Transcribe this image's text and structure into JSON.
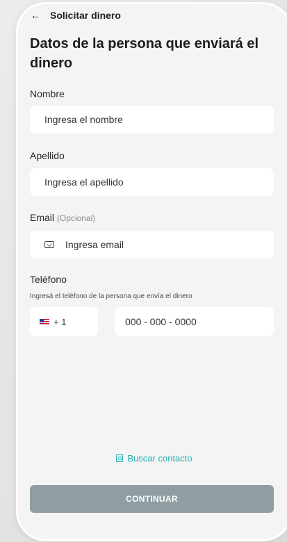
{
  "header": {
    "back_icon": "back-arrow-icon",
    "title": "Solicitar dinero"
  },
  "section": {
    "title": "Datos de la persona que enviará el dinero"
  },
  "form": {
    "name": {
      "label": "Nombre",
      "placeholder": "Ingresa el nombre"
    },
    "lastname": {
      "label": "Apellido",
      "placeholder": "Ingresa el apellido"
    },
    "email": {
      "label": "Email",
      "optional": "(Opcional)",
      "placeholder": "Ingresa email",
      "icon": "mail-icon"
    },
    "phone": {
      "label": "Teléfono",
      "helper": "Ingresá el teléfono de la persona que envía el dinero",
      "country_code": "+ 1",
      "country_flag": "us-flag-icon",
      "placeholder": "000 - 000 - 0000"
    }
  },
  "actions": {
    "search_contact": "Buscar contacto",
    "continue": "CONTINUAR"
  },
  "colors": {
    "accent": "#1fb0b0",
    "button_disabled": "#8e9ea3",
    "background": "#f4f4f4"
  }
}
